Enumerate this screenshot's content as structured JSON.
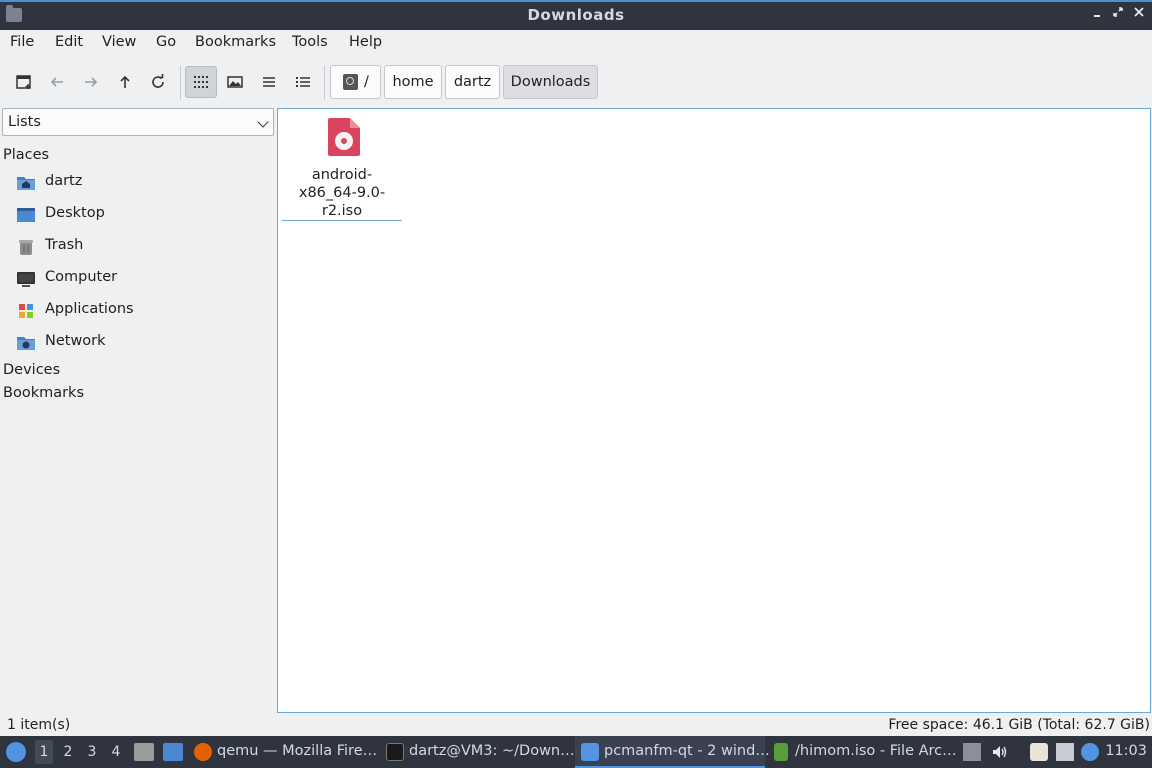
{
  "window": {
    "title": "Downloads"
  },
  "menu": [
    "File",
    "Edit",
    "View",
    "Go",
    "Bookmarks",
    "Tools",
    "Help"
  ],
  "toolbar": {
    "buttons": [
      "new-tab-icon",
      "back-icon",
      "forward-icon",
      "up-icon",
      "reload-icon",
      "icon-view-icon",
      "thumbnail-view-icon",
      "compact-view-icon",
      "detailed-list-icon"
    ],
    "active_view": "icon-view"
  },
  "breadcrumb": [
    "/",
    "home",
    "dartz",
    "Downloads"
  ],
  "sidebar": {
    "mode": "Lists",
    "places_title": "Places",
    "places": [
      {
        "label": "dartz",
        "icon": "home-folder-icon"
      },
      {
        "label": "Desktop",
        "icon": "desktop-icon"
      },
      {
        "label": "Trash",
        "icon": "trash-icon"
      },
      {
        "label": "Computer",
        "icon": "computer-icon"
      },
      {
        "label": "Applications",
        "icon": "applications-icon"
      },
      {
        "label": "Network",
        "icon": "network-icon"
      }
    ],
    "devices_title": "Devices",
    "bookmarks_title": "Bookmarks"
  },
  "files": [
    {
      "name_line1": "android-",
      "name_line2": "x86_64-9.0-r2.iso",
      "icon": "disc-image-icon"
    }
  ],
  "status": {
    "items": "1 item(s)",
    "free_space": "Free space: 46.1 GiB (Total: 62.7 GiB)"
  },
  "taskbar": {
    "workspaces": [
      "1",
      "2",
      "3",
      "4"
    ],
    "active_workspace": "1",
    "tasks": [
      {
        "label": "qemu — Mozilla Fire…",
        "icon": "firefox-icon"
      },
      {
        "label": "dartz@VM3: ~/Down…",
        "icon": "terminal-icon"
      },
      {
        "label": "pcmanfm-qt - 2 wind…",
        "icon": "file-manager-icon",
        "active": true
      },
      {
        "label": "/himom.iso - File Arc…",
        "icon": "archive-icon"
      }
    ],
    "clock": "11:03"
  },
  "colors": {
    "titlebar_bg": "#2f343f",
    "accent": "#5294e2",
    "iso_icon": "#d9455f",
    "window_bg": "#eff0f1"
  }
}
